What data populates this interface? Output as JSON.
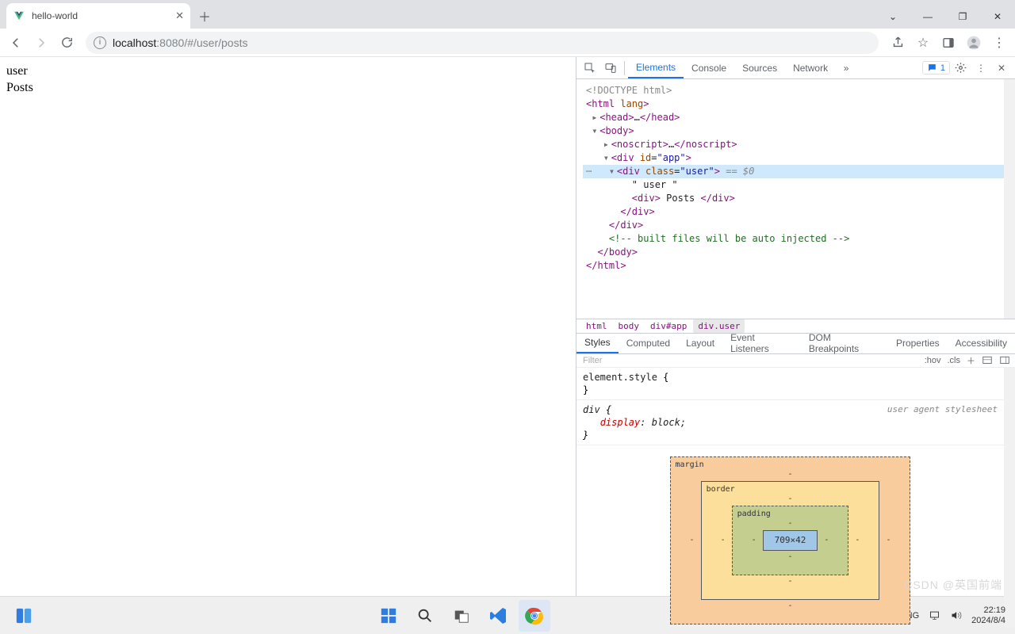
{
  "browser": {
    "tab_title": "hello-world",
    "url_host": "localhost",
    "url_port": ":8080",
    "url_path": "/#/user/posts"
  },
  "page": {
    "line1": "user",
    "line2": "Posts"
  },
  "devtools": {
    "tabs": [
      "Elements",
      "Console",
      "Sources",
      "Network"
    ],
    "active_tab": "Elements",
    "issues_count": "1",
    "dom": {
      "l0": "<!DOCTYPE html>",
      "l1_open": "<html ",
      "l1_attr": "lang",
      "l1_close": ">",
      "l2_open": "<head>",
      "l2_ell": "…",
      "l2_close": "</head>",
      "l3": "<body>",
      "l4_open": "<noscript>",
      "l4_ell": "…",
      "l4_close": "</noscript>",
      "l5_open": "<div ",
      "l5_attrn": "id",
      "l5_attrv": "\"app\"",
      "l5_close": ">",
      "l6_open": "<div ",
      "l6_attrn": "class",
      "l6_attrv": "\"user\"",
      "l6_close": ">",
      "l6_mark": " == $0",
      "l7": "\" user \"",
      "l8_open": "<div>",
      "l8_txt": " Posts ",
      "l8_close": "</div>",
      "l9": "</div>",
      "l10": "</div>",
      "l11": "<!-- built files will be auto injected -->",
      "l12": "</body>",
      "l13": "</html>"
    },
    "crumbs": [
      "html",
      "body",
      "div#app",
      "div.user"
    ],
    "subtabs": [
      "Styles",
      "Computed",
      "Layout",
      "Event Listeners",
      "DOM Breakpoints",
      "Properties",
      "Accessibility"
    ],
    "active_subtab": "Styles",
    "styles_toolbar": {
      "filter_placeholder": "Filter",
      "hov": ":hov",
      "cls": ".cls"
    },
    "rules": {
      "r1_sel": "element.style",
      "r1_open": " {",
      "r1_close": "}",
      "r2_sel": "div",
      "r2_open": " {",
      "r2_prop": "display",
      "r2_val": ": block;",
      "r2_close": "}",
      "r2_origin": "user agent stylesheet"
    },
    "box_model": {
      "margin_label": "margin",
      "border_label": "border",
      "padding_label": "padding",
      "content": "709×42",
      "dash": "-"
    }
  },
  "taskbar": {
    "lang": "ENG",
    "time": "22:19",
    "date": "2024/8/4"
  },
  "watermark": "CSDN @英国前端"
}
